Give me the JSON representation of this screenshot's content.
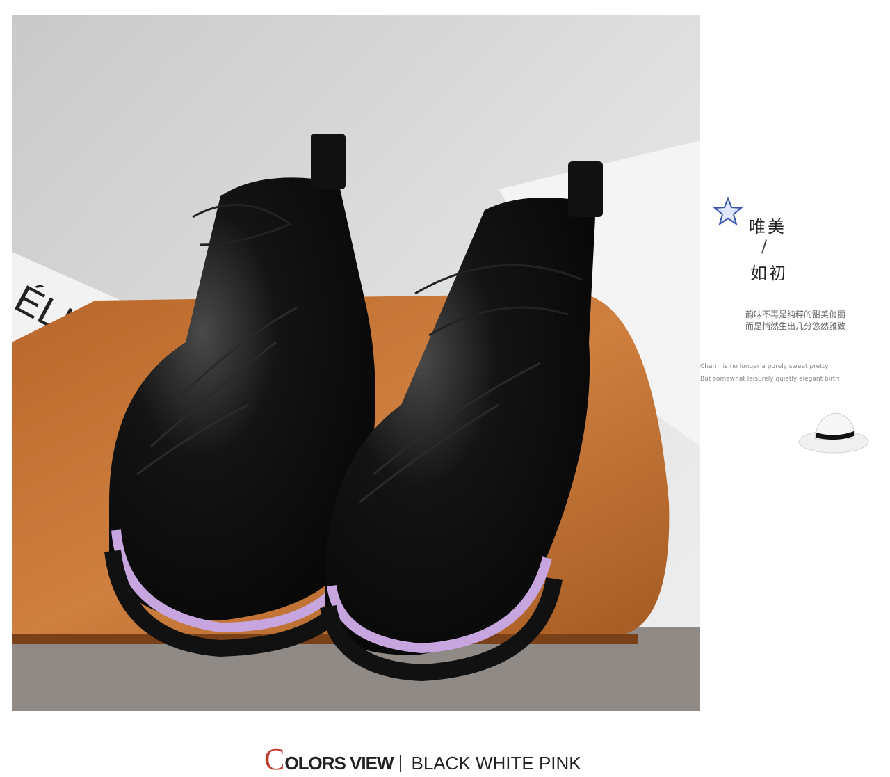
{
  "photo": {
    "wall_sign_text": "ÉLINE",
    "description_icon": "boots-photo"
  },
  "side_panel": {
    "star_icon": "starfish-icon",
    "title_line1": "唯美",
    "title_separator": "/",
    "title_line2": "如初",
    "chinese_line1": "韵味不再是纯粹的甜美俏丽",
    "chinese_line2": "而是悄然生出几分悠然雅致",
    "english_line1": "Charm is no longer a purely sweet pretty",
    "english_line2": "But somewhat leisurely quietly elegant birth",
    "hat_icon": "hat-icon"
  },
  "footer": {
    "initial": "C",
    "heading_rest": "OLORS VIEW",
    "colors": "BLACK WHITE PINK",
    "accent_color": "#c0392b"
  }
}
